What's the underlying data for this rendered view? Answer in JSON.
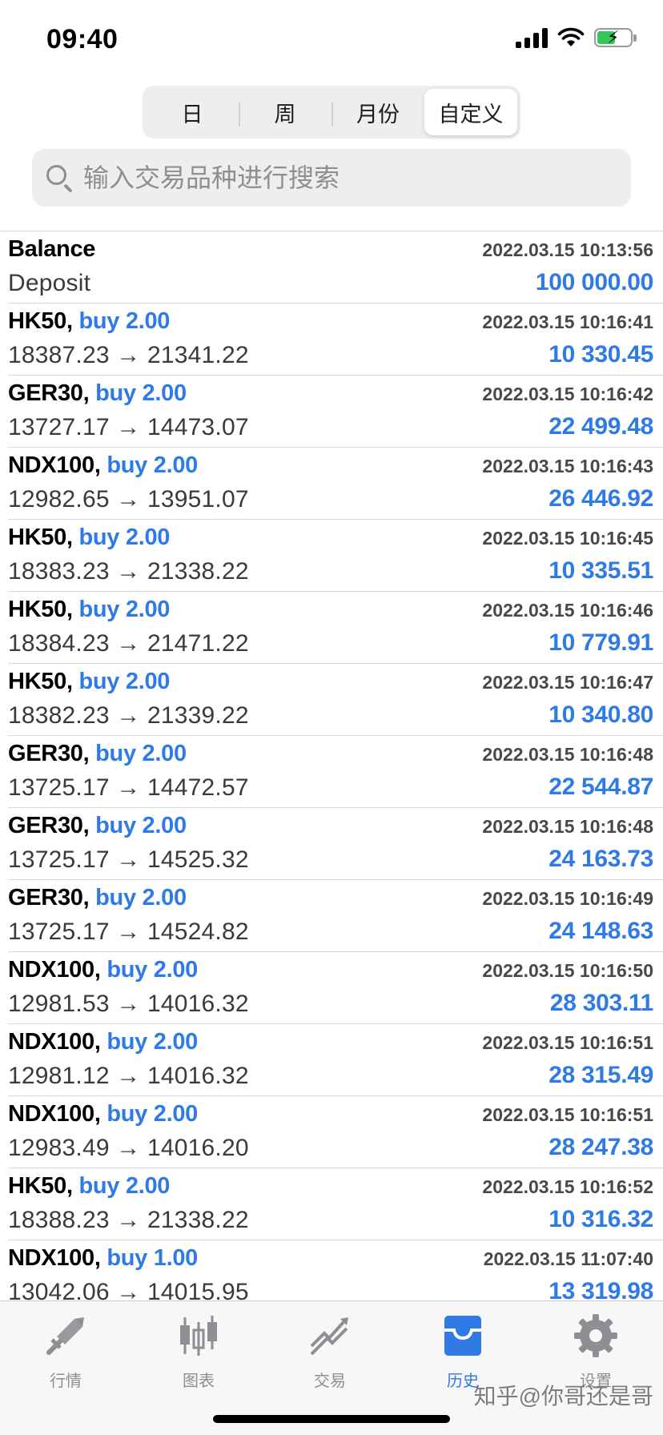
{
  "status_bar": {
    "time": "09:40"
  },
  "segments": [
    "日",
    "周",
    "月份",
    "自定义"
  ],
  "active_segment": 3,
  "search": {
    "placeholder": "输入交易品种进行搜索"
  },
  "rows": [
    {
      "title": "Balance",
      "sep": "",
      "action": "",
      "sub": "Deposit",
      "time": "2022.03.15 10:13:56",
      "amount": "100 000.00"
    },
    {
      "title": "HK50",
      "sep": ", ",
      "action": "buy 2.00",
      "sub": "18387.23 → 21341.22",
      "time": "2022.03.15 10:16:41",
      "amount": "10 330.45"
    },
    {
      "title": "GER30",
      "sep": ", ",
      "action": "buy 2.00",
      "sub": "13727.17 → 14473.07",
      "time": "2022.03.15 10:16:42",
      "amount": "22 499.48"
    },
    {
      "title": "NDX100",
      "sep": ", ",
      "action": "buy 2.00",
      "sub": "12982.65 → 13951.07",
      "time": "2022.03.15 10:16:43",
      "amount": "26 446.92"
    },
    {
      "title": "HK50",
      "sep": ", ",
      "action": "buy 2.00",
      "sub": "18383.23 → 21338.22",
      "time": "2022.03.15 10:16:45",
      "amount": "10 335.51"
    },
    {
      "title": "HK50",
      "sep": ", ",
      "action": "buy 2.00",
      "sub": "18384.23 → 21471.22",
      "time": "2022.03.15 10:16:46",
      "amount": "10 779.91"
    },
    {
      "title": "HK50",
      "sep": ", ",
      "action": "buy 2.00",
      "sub": "18382.23 → 21339.22",
      "time": "2022.03.15 10:16:47",
      "amount": "10 340.80"
    },
    {
      "title": "GER30",
      "sep": ", ",
      "action": "buy 2.00",
      "sub": "13725.17 → 14472.57",
      "time": "2022.03.15 10:16:48",
      "amount": "22 544.87"
    },
    {
      "title": "GER30",
      "sep": ", ",
      "action": "buy 2.00",
      "sub": "13725.17 → 14525.32",
      "time": "2022.03.15 10:16:48",
      "amount": "24 163.73"
    },
    {
      "title": "GER30",
      "sep": ", ",
      "action": "buy 2.00",
      "sub": "13725.17 → 14524.82",
      "time": "2022.03.15 10:16:49",
      "amount": "24 148.63"
    },
    {
      "title": "NDX100",
      "sep": ", ",
      "action": "buy 2.00",
      "sub": "12981.53 → 14016.32",
      "time": "2022.03.15 10:16:50",
      "amount": "28 303.11"
    },
    {
      "title": "NDX100",
      "sep": ", ",
      "action": "buy 2.00",
      "sub": "12981.12 → 14016.32",
      "time": "2022.03.15 10:16:51",
      "amount": "28 315.49"
    },
    {
      "title": "NDX100",
      "sep": ", ",
      "action": "buy 2.00",
      "sub": "12983.49 → 14016.20",
      "time": "2022.03.15 10:16:51",
      "amount": "28 247.38"
    },
    {
      "title": "HK50",
      "sep": ", ",
      "action": "buy 2.00",
      "sub": "18388.23 → 21338.22",
      "time": "2022.03.15 10:16:52",
      "amount": "10 316.32"
    },
    {
      "title": "NDX100",
      "sep": ", ",
      "action": "buy 1.00",
      "sub": "13042.06 → 14015.95",
      "time": "2022.03.15 11:07:40",
      "amount": "13 319.98"
    }
  ],
  "tabbar": [
    {
      "label": "行情",
      "icon": "quotes-icon"
    },
    {
      "label": "图表",
      "icon": "chart-icon"
    },
    {
      "label": "交易",
      "icon": "trade-icon"
    },
    {
      "label": "历史",
      "icon": "history-icon"
    },
    {
      "label": "设置",
      "icon": "settings-icon"
    }
  ],
  "active_tab": 3,
  "watermark": "知乎@你哥还是哥",
  "colors": {
    "accent": "#2f7ae5",
    "battery": "#34c759"
  }
}
